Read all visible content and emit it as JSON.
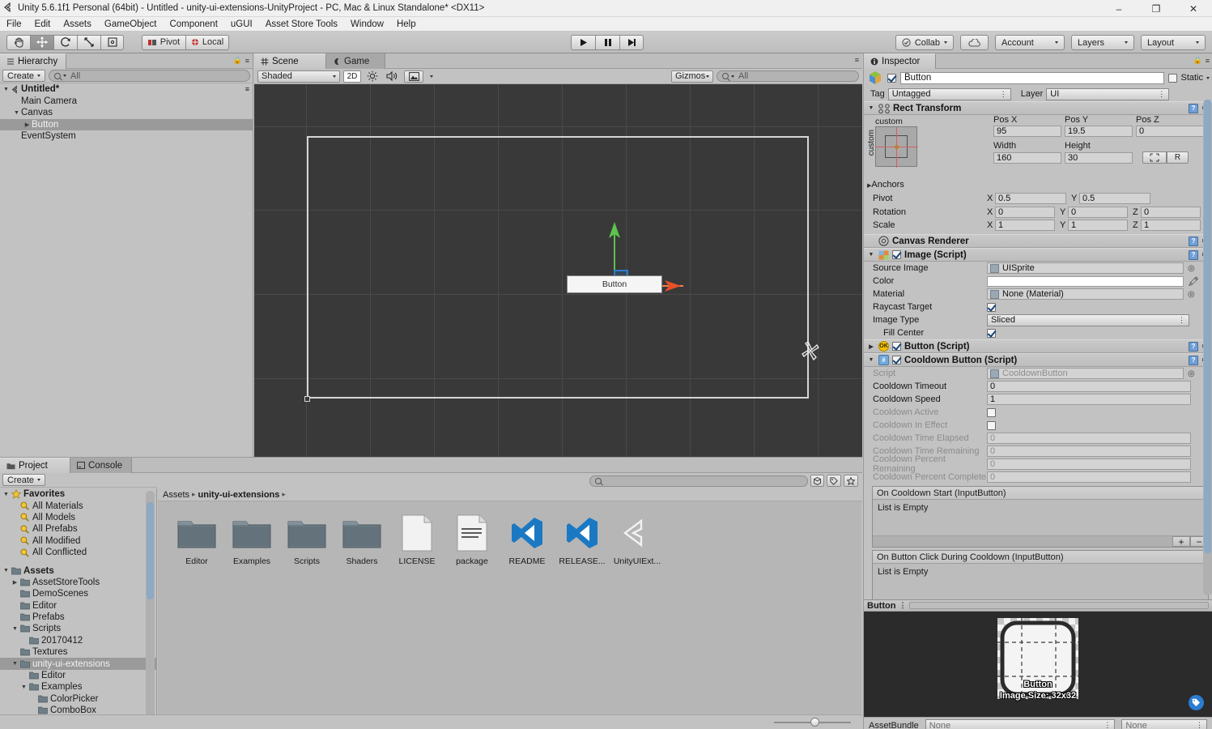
{
  "window": {
    "title": "Unity 5.6.1f1 Personal (64bit) - Untitled - unity-ui-extensions-UnityProject - PC, Mac & Linux Standalone* <DX11>",
    "minimize": "–",
    "maximize": "❐",
    "close": "✕"
  },
  "menu": {
    "items": [
      "File",
      "Edit",
      "Assets",
      "GameObject",
      "Component",
      "uGUI",
      "Asset Store Tools",
      "Window",
      "Help"
    ]
  },
  "toolbar": {
    "tools": [
      {
        "name": "hand-tool",
        "glyph": "✋",
        "active": false
      },
      {
        "name": "move-tool",
        "glyph": "✥",
        "active": true
      },
      {
        "name": "rotate-tool",
        "glyph": "↻",
        "active": false
      },
      {
        "name": "scale-tool",
        "glyph": "⤡",
        "active": false
      },
      {
        "name": "rect-tool",
        "glyph": "▣",
        "active": false
      }
    ],
    "pivot_label": "Pivot",
    "local_label": "Local",
    "play_label": "▶",
    "pause_label": "❙❙",
    "step_label": "▶❙",
    "collab_label": "Collab",
    "cloud_label": "cloud-icon",
    "account_label": "Account",
    "layers_label": "Layers",
    "layout_label": "Layout"
  },
  "hierarchy": {
    "tab_label": "Hierarchy",
    "create_label": "Create",
    "search_placeholder": "All",
    "scene_name": "Untitled*",
    "items": [
      {
        "label": "Main Camera",
        "depth": 1,
        "expandable": false,
        "selected": false
      },
      {
        "label": "Canvas",
        "depth": 1,
        "expandable": true,
        "expanded": true,
        "selected": false
      },
      {
        "label": "Button",
        "depth": 2,
        "expandable": true,
        "expanded": false,
        "selected": true
      },
      {
        "label": "EventSystem",
        "depth": 1,
        "expandable": false,
        "selected": false
      }
    ]
  },
  "scene": {
    "tabs": [
      {
        "label": "Scene",
        "active": true,
        "icon": "scene-grid-icon"
      },
      {
        "label": "Game",
        "active": false,
        "icon": "game-pad-icon"
      }
    ],
    "shading_mode": "Shaded",
    "two_d_label": "2D",
    "lighting_icon": "sun-icon",
    "audio_icon": "speaker-icon",
    "fx_icon": "image-icon",
    "gizmos_label": "Gizmos",
    "search_placeholder": "All",
    "object_label": "Button"
  },
  "project": {
    "tabs": [
      {
        "label": "Project",
        "active": true,
        "icon": "folder-icon"
      },
      {
        "label": "Console",
        "active": false,
        "icon": "console-icon"
      }
    ],
    "create_label": "Create",
    "search_placeholder": "",
    "breadcrumb": [
      "Assets",
      "unity-ui-extensions"
    ],
    "tree": [
      {
        "label": "Favorites",
        "depth": 0,
        "icon": "star-icon",
        "bold": true,
        "tri": "down"
      },
      {
        "label": "All Materials",
        "depth": 1,
        "icon": "search-icon",
        "bold": false,
        "tri": "none"
      },
      {
        "label": "All Models",
        "depth": 1,
        "icon": "search-icon",
        "bold": false,
        "tri": "none"
      },
      {
        "label": "All Prefabs",
        "depth": 1,
        "icon": "search-icon",
        "bold": false,
        "tri": "none"
      },
      {
        "label": "All Modified",
        "depth": 1,
        "icon": "search-icon",
        "bold": false,
        "tri": "none"
      },
      {
        "label": "All Conflicted",
        "depth": 1,
        "icon": "search-icon",
        "bold": false,
        "tri": "none"
      },
      {
        "label": "",
        "depth": 0,
        "icon": "none",
        "bold": false,
        "tri": "none"
      },
      {
        "label": "Assets",
        "depth": 0,
        "icon": "folder-icon",
        "bold": true,
        "tri": "down"
      },
      {
        "label": "AssetStoreTools",
        "depth": 1,
        "icon": "folder-icon",
        "bold": false,
        "tri": "right"
      },
      {
        "label": "DemoScenes",
        "depth": 1,
        "icon": "folder-icon",
        "bold": false,
        "tri": "none"
      },
      {
        "label": "Editor",
        "depth": 1,
        "icon": "folder-icon",
        "bold": false,
        "tri": "none"
      },
      {
        "label": "Prefabs",
        "depth": 1,
        "icon": "folder-icon",
        "bold": false,
        "tri": "none"
      },
      {
        "label": "Scripts",
        "depth": 1,
        "icon": "folder-icon",
        "bold": false,
        "tri": "down"
      },
      {
        "label": "20170412",
        "depth": 2,
        "icon": "folder-icon",
        "bold": false,
        "tri": "none"
      },
      {
        "label": "Textures",
        "depth": 1,
        "icon": "folder-icon",
        "bold": false,
        "tri": "none"
      },
      {
        "label": "unity-ui-extensions",
        "depth": 1,
        "icon": "folder-icon",
        "bold": false,
        "tri": "down",
        "selected": true
      },
      {
        "label": "Editor",
        "depth": 2,
        "icon": "folder-icon",
        "bold": false,
        "tri": "none"
      },
      {
        "label": "Examples",
        "depth": 2,
        "icon": "folder-icon",
        "bold": false,
        "tri": "down"
      },
      {
        "label": "ColorPicker",
        "depth": 3,
        "icon": "folder-icon",
        "bold": false,
        "tri": "none"
      },
      {
        "label": "ComboBox",
        "depth": 3,
        "icon": "folder-icon",
        "bold": false,
        "tri": "none"
      }
    ],
    "assets": [
      {
        "label": "Editor",
        "type": "folder"
      },
      {
        "label": "Examples",
        "type": "folder"
      },
      {
        "label": "Scripts",
        "type": "folder"
      },
      {
        "label": "Shaders",
        "type": "folder"
      },
      {
        "label": "LICENSE",
        "type": "blankdoc"
      },
      {
        "label": "package",
        "type": "textdoc"
      },
      {
        "label": "README",
        "type": "vs"
      },
      {
        "label": "RELEASE...",
        "type": "vs"
      },
      {
        "label": "UnityUIExt...",
        "type": "unity"
      }
    ]
  },
  "inspector": {
    "tab_label": "Inspector",
    "object_name": "Button",
    "object_enabled": true,
    "static_label": "Static",
    "tag_label": "Tag",
    "tag_value": "Untagged",
    "layer_label": "Layer",
    "layer_value": "UI",
    "rect_transform": {
      "title": "Rect Transform",
      "anchor_preset_label": "custom",
      "anchor_side_label": "custom",
      "headers": [
        "Pos X",
        "Pos Y",
        "Pos Z"
      ],
      "pos": [
        "95",
        "19.5",
        "0"
      ],
      "size_headers": [
        "Width",
        "Height"
      ],
      "size": [
        "160",
        "30"
      ],
      "blueprint_label": "⬚",
      "raw_label": "R",
      "anchors_label": "Anchors",
      "pivot_label": "Pivot",
      "pivot": [
        "0.5",
        "0.5"
      ],
      "rotation_label": "Rotation",
      "rotation": [
        "0",
        "0",
        "0"
      ],
      "scale_label": "Scale",
      "scale": [
        "1",
        "1",
        "1"
      ],
      "axes": [
        "X",
        "Y",
        "Z"
      ]
    },
    "canvas_renderer": {
      "title": "Canvas Renderer"
    },
    "image_script": {
      "title": "Image (Script)",
      "enabled": true,
      "rows": [
        {
          "label": "Source Image",
          "value": "UISprite",
          "kind": "object"
        },
        {
          "label": "Color",
          "value": "",
          "kind": "color"
        },
        {
          "label": "Material",
          "value": "None (Material)",
          "kind": "object"
        },
        {
          "label": "Raycast Target",
          "value": "",
          "kind": "checkbox",
          "checked": true
        },
        {
          "label": "Image Type",
          "value": "Sliced",
          "kind": "dropdown"
        },
        {
          "label": "Fill Center",
          "value": "",
          "kind": "checkbox",
          "checked": true,
          "indent": true
        }
      ]
    },
    "button_script": {
      "title": "Button (Script)",
      "enabled": true
    },
    "cooldown_button": {
      "title": "Cooldown Button (Script)",
      "enabled": true,
      "rows": [
        {
          "label": "Script",
          "value": "CooldownButton",
          "kind": "object",
          "dim": true
        },
        {
          "label": "Cooldown Timeout",
          "value": "0",
          "kind": "text"
        },
        {
          "label": "Cooldown Speed",
          "value": "1",
          "kind": "text"
        },
        {
          "label": "Cooldown Active",
          "value": "",
          "kind": "checkbox",
          "checked": false,
          "dim": true
        },
        {
          "label": "Cooldown In Effect",
          "value": "",
          "kind": "checkbox",
          "checked": false,
          "dim": true
        },
        {
          "label": "Cooldown Time Elapsed",
          "value": "0",
          "kind": "text",
          "dim": true
        },
        {
          "label": "Cooldown Time Remaining",
          "value": "0",
          "kind": "text",
          "dim": true
        },
        {
          "label": "Cooldown Percent Remaining",
          "value": "0",
          "kind": "text",
          "dim": true
        },
        {
          "label": "Cooldown Percent Complete",
          "value": "0",
          "kind": "text",
          "dim": true
        }
      ],
      "events": [
        {
          "title": "On Cooldown Start (InputButton)",
          "body": "List is Empty",
          "add": "+",
          "remove": "−"
        },
        {
          "title": "On Button Click During Cooldown (InputButton)",
          "body": "List is Empty",
          "add": "+",
          "remove": "−"
        }
      ]
    },
    "preview": {
      "title": "Button",
      "overlay_name": "Button",
      "overlay_size": "Image Size: 32x32",
      "assetbundle_label": "AssetBundle",
      "bundle_value": "None",
      "variant_value": "None"
    }
  },
  "colors": {
    "panel_bg": "#c2c2c2",
    "scene_bg": "#393939",
    "accent_blue": "#2b7cd3",
    "selection": "#9a9a9a",
    "gizmo_green": "#5ec24f",
    "gizmo_red": "#e8502a",
    "gizmo_blue": "#2b7cd3"
  }
}
